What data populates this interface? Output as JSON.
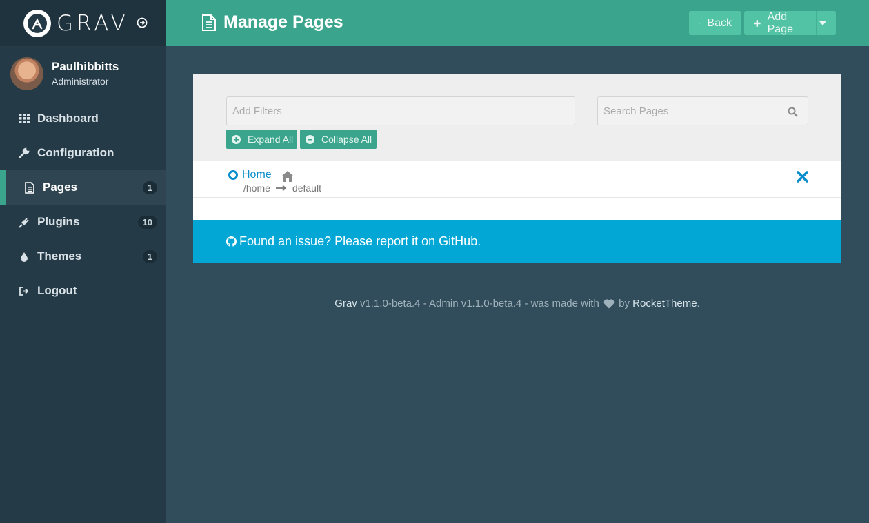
{
  "brand": {
    "name": "GRAV"
  },
  "user": {
    "name": "Paulhibbitts",
    "role": "Administrator"
  },
  "sidebar": {
    "items": [
      {
        "label": "Dashboard",
        "icon": "grid-icon",
        "badge": null
      },
      {
        "label": "Configuration",
        "icon": "wrench-icon",
        "badge": null
      },
      {
        "label": "Pages",
        "icon": "file-icon",
        "badge": "1",
        "active": true
      },
      {
        "label": "Plugins",
        "icon": "plug-icon",
        "badge": "10"
      },
      {
        "label": "Themes",
        "icon": "tint-icon",
        "badge": "1"
      },
      {
        "label": "Logout",
        "icon": "sign-out-icon",
        "badge": null
      }
    ]
  },
  "header": {
    "title": "Manage Pages",
    "back_label": "Back",
    "add_label": "Add Page"
  },
  "filters": {
    "filters_placeholder": "Add Filters",
    "search_placeholder": "Search Pages",
    "expand_label": "Expand All",
    "collapse_label": "Collapse All"
  },
  "pages": [
    {
      "title": "Home",
      "route": "/home",
      "template": "default"
    }
  ],
  "notice": {
    "text": "Found an issue? Please report it on GitHub."
  },
  "footer": {
    "grav": "Grav",
    "version_text": " v1.1.0-beta.4 - Admin v1.1.0-beta.4 - was made with ",
    "by": " by ",
    "rockettheme": "RocketTheme",
    "end": "."
  },
  "colors": {
    "accent": "#3aa58c",
    "sidebar": "#253a47",
    "notice": "#03a7d6",
    "link": "#0a8ecb"
  }
}
